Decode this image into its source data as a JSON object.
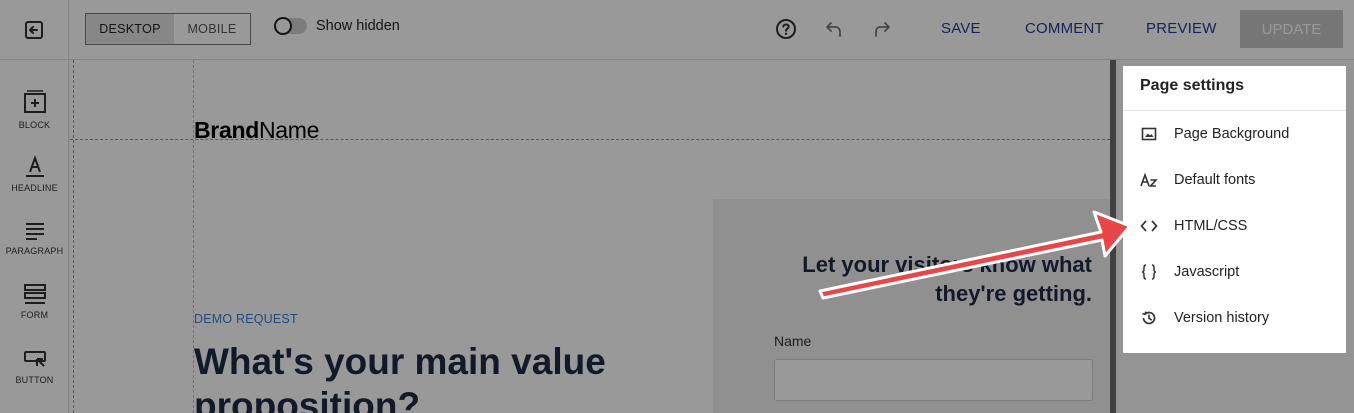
{
  "toolbar": {
    "view_desktop": "DESKTOP",
    "view_mobile": "MOBILE",
    "show_hidden": "Show hidden",
    "save": "SAVE",
    "comment": "COMMENT",
    "preview": "PREVIEW",
    "update": "UPDATE"
  },
  "tools": [
    {
      "label": "BLOCK"
    },
    {
      "label": "HEADLINE"
    },
    {
      "label": "PARAGRAPH"
    },
    {
      "label": "FORM"
    },
    {
      "label": "BUTTON"
    }
  ],
  "canvas": {
    "brand_bold": "Brand",
    "brand_regular": "Name",
    "eyebrow": "DEMO REQUEST",
    "hero": "What's your main value proposition?",
    "form_title": "Let your visitors know what they're getting.",
    "form_label": "Name"
  },
  "page_settings": {
    "title": "Page settings",
    "items": [
      {
        "label": "Page Background",
        "icon": "image-icon"
      },
      {
        "label": "Default fonts",
        "icon": "font-az-icon"
      },
      {
        "label": "HTML/CSS",
        "icon": "code-brackets-icon"
      },
      {
        "label": "Javascript",
        "icon": "curly-braces-icon"
      },
      {
        "label": "Version history",
        "icon": "history-icon"
      }
    ]
  },
  "colors": {
    "link": "#2b3a8f",
    "accent_arrow": "#e8474a",
    "eyebrow": "#3c7bd6"
  }
}
